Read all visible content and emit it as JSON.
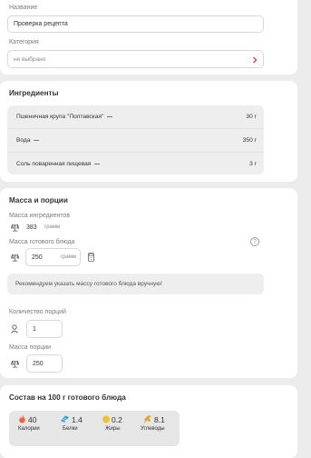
{
  "recipe": {
    "name_label": "Название",
    "name_value": "Проверка рецепта",
    "category_label": "Категория",
    "category_value": "не выбрано"
  },
  "ingredients": {
    "title": "Ингредиенты",
    "items": [
      {
        "name": "Пшеничная крупа \"Полтавская\"",
        "amount": "30 г"
      },
      {
        "name": "Вода",
        "amount": "350 г"
      },
      {
        "name": "Соль поваренная пищевая",
        "amount": "3 г"
      }
    ]
  },
  "mass": {
    "title": "Масса и порции",
    "ingredients_mass_label": "Масса ингредиентов",
    "ingredients_mass_value": "383",
    "ingredients_mass_unit": "грамм",
    "ready_mass_label": "Масса готового блюда",
    "ready_mass_value": "250",
    "ready_mass_unit": "грамм",
    "help_icon_glyph": "?",
    "notice": "Рекомендуем указать массу готового блюда вручную!",
    "portions_label": "Количество порций",
    "portions_value": "1",
    "portion_mass_label": "Масса порции",
    "portion_mass_value": "250"
  },
  "composition": {
    "title": "Состав на 100 г готового блюда",
    "nutrients": [
      {
        "value": "40",
        "label": "Калории",
        "icon": "flame-icon",
        "color": "#f0653a"
      },
      {
        "value": "1.4",
        "label": "Белки",
        "icon": "protein-icon",
        "color": "#2aa7c9"
      },
      {
        "value": "0.2",
        "label": "Жиры",
        "icon": "fat-drop-icon",
        "color": "#f2c12e"
      },
      {
        "value": "8.1",
        "label": "Углеводы",
        "icon": "wheat-icon",
        "color": "#e3a62c"
      }
    ]
  },
  "colors": {
    "accent": "#e63946",
    "notice_bg": "#eeeeee",
    "page_bg": "#ececec"
  }
}
